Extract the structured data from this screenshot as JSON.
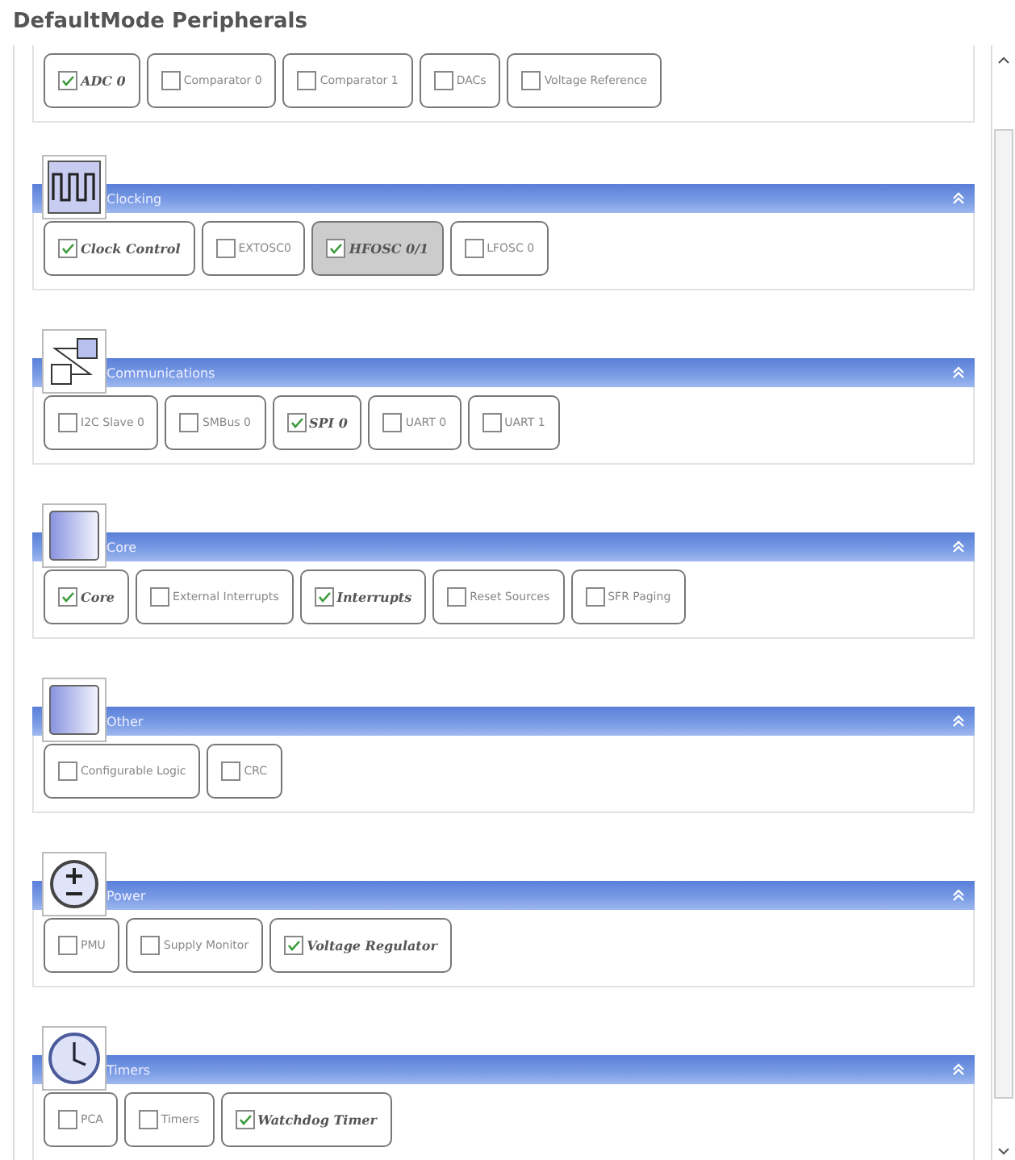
{
  "title": "DefaultMode Peripherals",
  "sections": [
    {
      "items": [
        {
          "label": "ADC 0",
          "checked": true,
          "selected": false
        },
        {
          "label": "Comparator 0",
          "checked": false,
          "selected": false
        },
        {
          "label": "Comparator 1",
          "checked": false,
          "selected": false
        },
        {
          "label": "DACs",
          "checked": false,
          "selected": false
        },
        {
          "label": "Voltage Reference",
          "checked": false,
          "selected": false
        }
      ]
    },
    {
      "name": "Clocking",
      "kind": "wave",
      "items": [
        {
          "label": "Clock Control",
          "checked": true,
          "selected": false
        },
        {
          "label": "EXTOSC0",
          "checked": false,
          "selected": false
        },
        {
          "label": "HFOSC 0/1",
          "checked": true,
          "selected": true
        },
        {
          "label": "LFOSC 0",
          "checked": false,
          "selected": false
        }
      ]
    },
    {
      "name": "Communications",
      "kind": "link",
      "items": [
        {
          "label": "I2C Slave 0",
          "checked": false,
          "selected": false
        },
        {
          "label": "SMBus 0",
          "checked": false,
          "selected": false
        },
        {
          "label": "SPI 0",
          "checked": true,
          "selected": false
        },
        {
          "label": "UART 0",
          "checked": false,
          "selected": false
        },
        {
          "label": "UART 1",
          "checked": false,
          "selected": false
        }
      ]
    },
    {
      "name": "Core",
      "kind": "square",
      "items": [
        {
          "label": "Core",
          "checked": true,
          "selected": false
        },
        {
          "label": "External Interrupts",
          "checked": false,
          "selected": false
        },
        {
          "label": "Interrupts",
          "checked": true,
          "selected": false
        },
        {
          "label": "Reset Sources",
          "checked": false,
          "selected": false
        },
        {
          "label": "SFR Paging",
          "checked": false,
          "selected": false
        }
      ]
    },
    {
      "name": "Other",
      "kind": "square",
      "items": [
        {
          "label": "Configurable Logic",
          "checked": false,
          "selected": false
        },
        {
          "label": "CRC",
          "checked": false,
          "selected": false
        }
      ]
    },
    {
      "name": "Power",
      "kind": "power",
      "items": [
        {
          "label": "PMU",
          "checked": false,
          "selected": false
        },
        {
          "label": "Supply Monitor",
          "checked": false,
          "selected": false
        },
        {
          "label": "Voltage Regulator",
          "checked": true,
          "selected": false
        }
      ]
    },
    {
      "name": "Timers",
      "kind": "clock",
      "items": [
        {
          "label": "PCA",
          "checked": false,
          "selected": false
        },
        {
          "label": "Timers",
          "checked": false,
          "selected": false
        },
        {
          "label": "Watchdog Timer",
          "checked": true,
          "selected": false
        }
      ]
    }
  ]
}
